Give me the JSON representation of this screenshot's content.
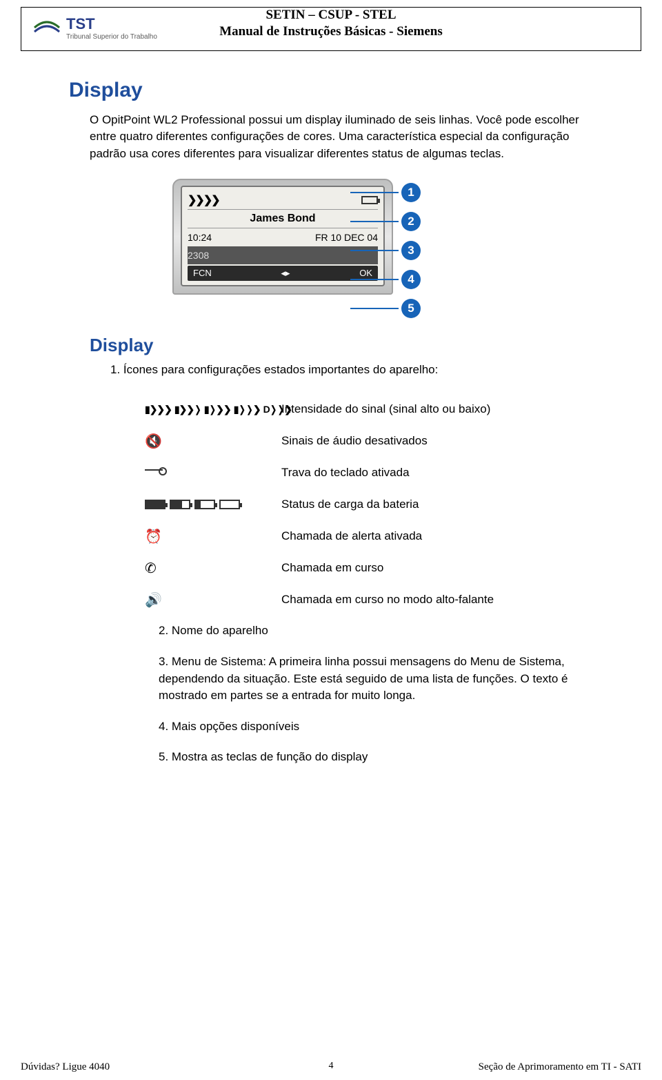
{
  "header": {
    "line1": "SETIN – CSUP - STEL",
    "line2": "Manual de Instruções Básicas - Siemens",
    "logo_top": "TST",
    "logo_bottom": "Tribunal Superior do Trabalho"
  },
  "section": {
    "title1": "Display",
    "para1": "O OpitPoint WL2 Professional possui um display iluminado de seis linhas. Você pode escolher entre quatro diferentes configurações de cores. Uma característica especial da configuração padrão usa cores diferentes para visualizar diferentes status de algumas teclas.",
    "title2": "Display",
    "item1": "1.  Ícones para configurações estados importantes do aparelho:"
  },
  "phone": {
    "signal": "❯❯❯❯",
    "name": "James Bond",
    "time": "10:24",
    "date": "FR 10 DEC 04",
    "ext": "2308",
    "soft_left": "FCN",
    "soft_mid": "◂▸",
    "soft_right": "OK",
    "callouts": [
      "1",
      "2",
      "3",
      "4",
      "5"
    ]
  },
  "icons": {
    "signal": "Intensidade do sinal (sinal alto ou baixo)",
    "mute": "Sinais de áudio desativados",
    "keylock": "Trava do teclado ativada",
    "battery": "Status de carga da bateria",
    "alarm": "Chamada de alerta ativada",
    "call": "Chamada em curso",
    "speaker": "Chamada em curso no modo alto-falante"
  },
  "numlist": {
    "n2": "2.  Nome do aparelho",
    "n3": "3.  Menu de Sistema: A primeira linha possui mensagens do Menu de Sistema, dependendo da situação.  Este está seguido de uma lista de funções. O texto é mostrado em partes se a entrada for muito longa.",
    "n4": "4.  Mais opções disponíveis",
    "n5": "5.   Mostra as teclas de função do display"
  },
  "footer": {
    "left": "Dúvidas? Ligue 4040",
    "right": "Seção de Aprimoramento em TI - SATI",
    "page": "4"
  }
}
